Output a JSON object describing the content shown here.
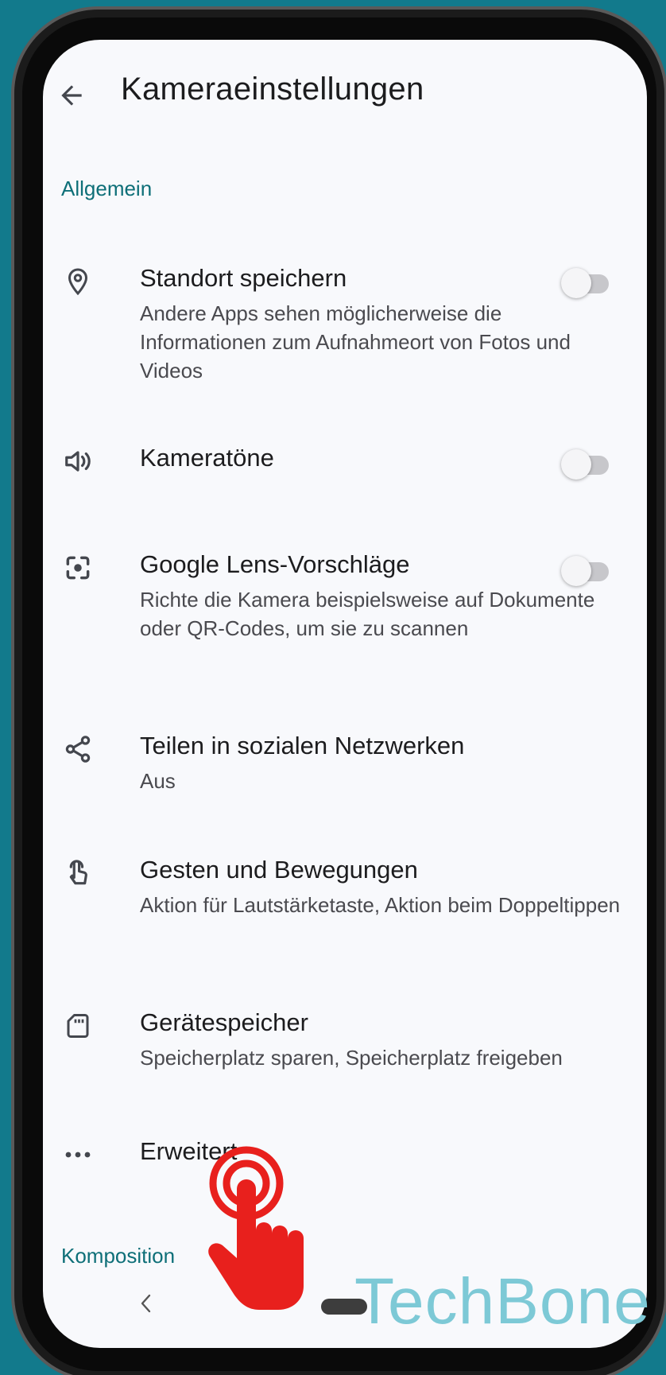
{
  "header": {
    "title": "Kameraeinstellungen"
  },
  "sections": {
    "general": "Allgemein",
    "composition": "Komposition"
  },
  "items": {
    "location": {
      "title": "Standort speichern",
      "subtitle": "Andere Apps sehen möglicherweise die Informationen zum Aufnahmeort von Fotos und Videos",
      "toggle_on": false,
      "icon": "location-pin-icon"
    },
    "sounds": {
      "title": "Kameratöne",
      "toggle_on": false,
      "icon": "volume-icon"
    },
    "lens": {
      "title": "Google Lens-Vorschläge",
      "subtitle": "Richte die Kamera beispielsweise auf Dokumente oder QR-Codes, um sie zu scannen",
      "toggle_on": false,
      "icon": "lens-icon"
    },
    "share": {
      "title": "Teilen in sozialen Netzwerken",
      "subtitle": "Aus",
      "icon": "share-icon"
    },
    "gestures": {
      "title": "Gesten und Bewegungen",
      "subtitle": "Aktion für Lautstärketaste, Aktion beim Doppeltippen",
      "icon": "gesture-hand-icon"
    },
    "storage": {
      "title": "Gerätespeicher",
      "subtitle": "Speicherplatz sparen, Speicherplatz freigeben",
      "icon": "sd-card-icon"
    },
    "advanced": {
      "title": "Erweitert",
      "icon": "more-dots-icon"
    }
  },
  "watermark": "TechBone",
  "colors": {
    "background": "#127a8c",
    "accent": "#0e6f78",
    "tap_indicator": "#e8201d"
  }
}
